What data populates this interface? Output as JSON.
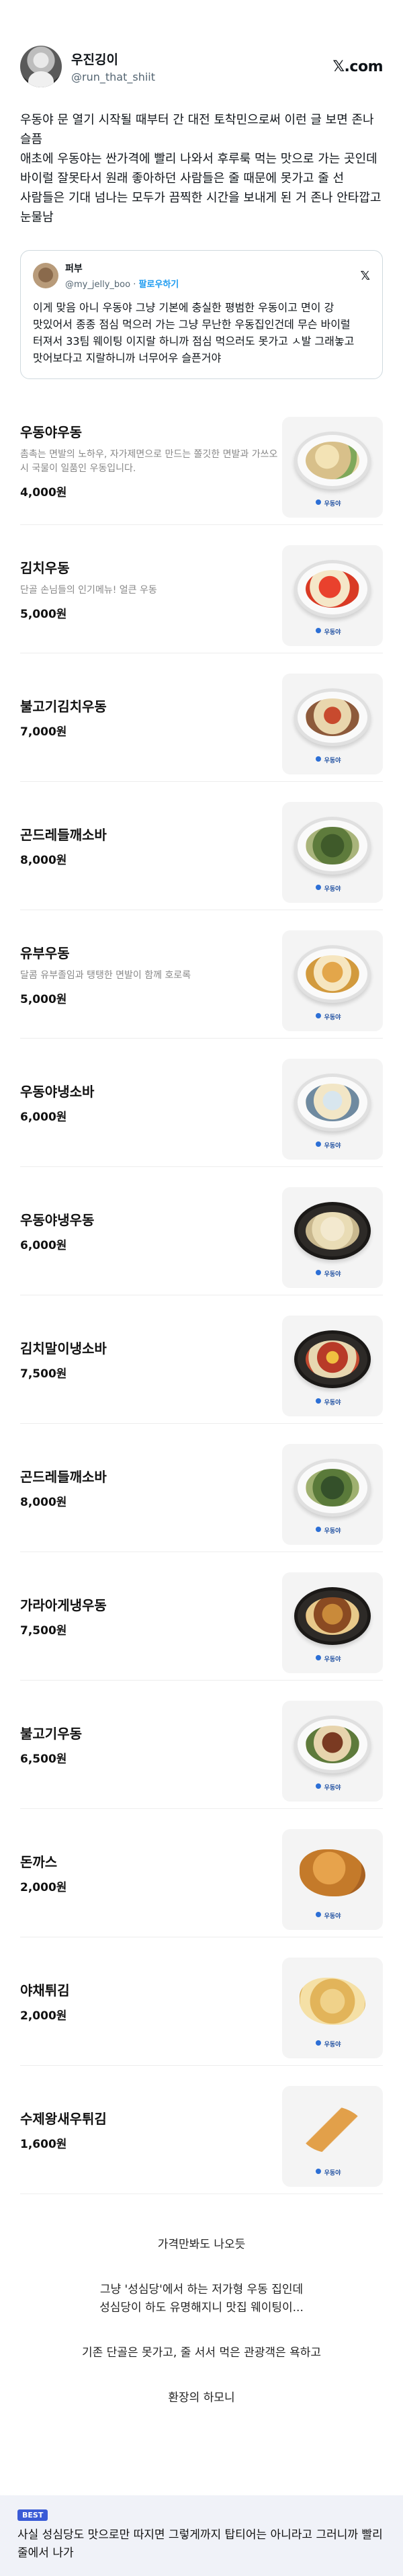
{
  "tweet": {
    "name": "우진깅이",
    "handle": "@run_that_shiit",
    "logo": "𝕏.com",
    "body": "우동야 문 열기 시작될 때부터 간 대전 토착민으로써 이런 글 보면 존나 슬픔\n애초에 우동야는 싼가격에 빨리 나와서 후루룩 먹는 맛으로 가는 곳인데 바이럴 잘못타서 원래 좋아하던 사람들은 줄 때문에 못가고 줄 선 사람들은 기대 넘나는 모두가 끔찍한 시간을 보내게 된 거 존나 안타깝고 눈물남"
  },
  "quote": {
    "name": "퍼부",
    "handle": "@my_jelly_boo",
    "follow": "팔로우하기",
    "x_icon": "x-logo",
    "body": "이게 맞음 아니 우동야 그냥 기본에 충실한 평범한 우동이고 면이 강 맛있어서 종종 점심 먹으러 가는 그냥 무난한 우동집인건데 무슨 바이럴 터져서 33팀 웨이팅 이지랄 하니까 점심 먹으러도 못가고 ㅅ발 그래놓고 맛어보다고 지랄하니까 너무어우 슬픈거야"
  },
  "menu": [
    {
      "name": "우동야우동",
      "desc": "촘촉는 면발의 노하우, 자가제면으로 만드는 쫄깃한 면발과 가쓰오시 국물이 일품인 우동입니다.",
      "price": "4,000원"
    },
    {
      "name": "김치우동",
      "desc": "단골 손님들의 인기메뉴! 얼큰 우동",
      "price": "5,000원"
    },
    {
      "name": "불고기김치우동",
      "desc": "",
      "price": "7,000원"
    },
    {
      "name": "곤드레들깨소바",
      "desc": "",
      "price": "8,000원"
    },
    {
      "name": "유부우동",
      "desc": "달콤 유부졸임과 탱탱한 면발이 함께 호로록",
      "price": "5,000원"
    },
    {
      "name": "우동야냉소바",
      "desc": "",
      "price": "6,000원"
    },
    {
      "name": "우동야냉우동",
      "desc": "",
      "price": "6,000원"
    },
    {
      "name": "김치말이냉소바",
      "desc": "",
      "price": "7,500원"
    },
    {
      "name": "곤드레들깨소바",
      "desc": "",
      "price": "8,000원"
    },
    {
      "name": "가라아게냉우동",
      "desc": "",
      "price": "7,500원"
    },
    {
      "name": "불고기우동",
      "desc": "",
      "price": "6,500원"
    },
    {
      "name": "돈까스",
      "desc": "",
      "price": "2,000원"
    },
    {
      "name": "야채튀김",
      "desc": "",
      "price": "2,000원"
    },
    {
      "name": "수제왕새우튀김",
      "desc": "",
      "price": "1,600원"
    }
  ],
  "brand_label": "우동야",
  "caption": {
    "line1": "가격만봐도 나오듯",
    "line2": "그냥 '성심당'에서 하는 저가형 우동 집인데",
    "line3": "성심당이 하도 유명해지니 맛집 웨이팅이...",
    "line4": "기존 단골은 못가고, 줄 서서 먹은 관광객은 욕하고",
    "line5": "환장의 하모니"
  },
  "best": {
    "badge": "BEST",
    "text": "사실 성심당도 맛으로만 따지면 그렇게까지 탑티어는 아니라고 그러니까 빨리 줄에서 나가"
  },
  "colors": {
    "accent_blue": "#1d9bf0",
    "best_badge": "#3a5bd6",
    "best_bg": "#f0f2f8"
  }
}
